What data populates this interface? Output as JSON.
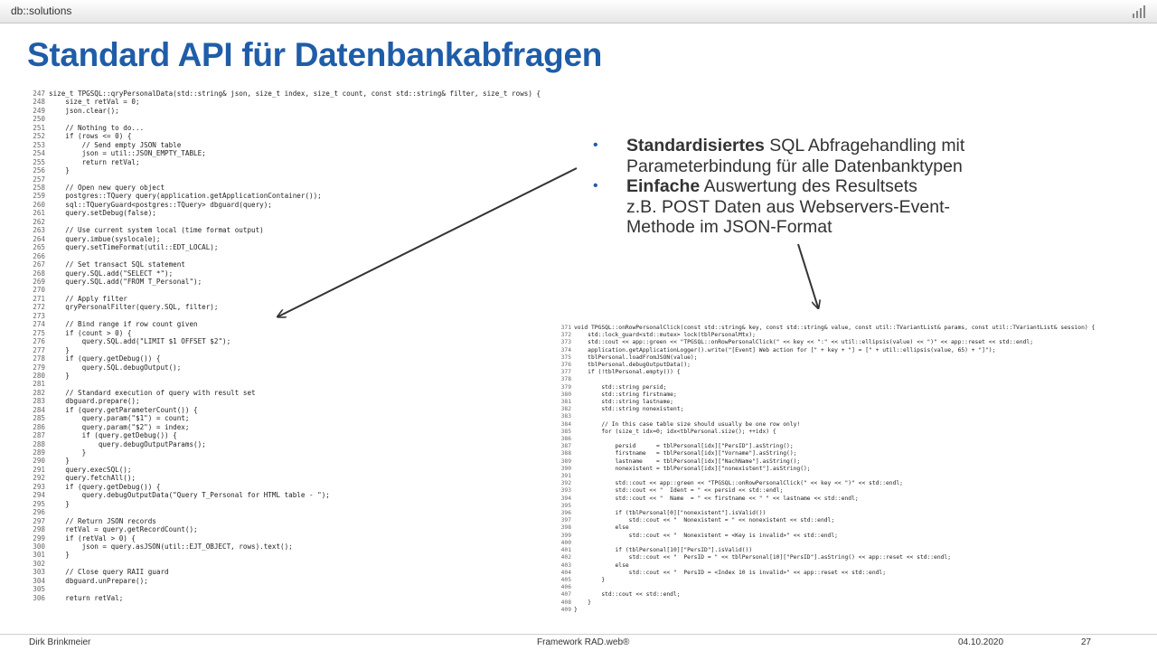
{
  "header": {
    "brand": "db::solutions",
    "logo_icon": "bars-icon"
  },
  "title": "Standard API für Datenbankabfragen",
  "bullets": [
    {
      "bold": "Standardisiertes",
      "lines": [
        " SQL Abfragehandling mit",
        "Parameterbindung für alle Datenbanktypen"
      ]
    },
    {
      "bold": "Einfache",
      "lines": [
        " Auswertung des Resultsets",
        "z.B. POST Daten aus Webservers-Event-",
        "Methode im JSON-Format"
      ]
    }
  ],
  "code_left": [
    [
      "247",
      "size_t TPGSQL::qryPersonalData(std::string& json, size_t index, size_t count, const std::string& filter, size_t rows) {"
    ],
    [
      "248",
      "    size_t retVal = 0;"
    ],
    [
      "249",
      "    json.clear();"
    ],
    [
      "250",
      ""
    ],
    [
      "251",
      "    // Nothing to do..."
    ],
    [
      "252",
      "    if (rows <= 0) {"
    ],
    [
      "253",
      "        // Send empty JSON table"
    ],
    [
      "254",
      "        json = util::JSON_EMPTY_TABLE;"
    ],
    [
      "255",
      "        return retVal;"
    ],
    [
      "256",
      "    }"
    ],
    [
      "257",
      ""
    ],
    [
      "258",
      "    // Open new query object"
    ],
    [
      "259",
      "    postgres::TQuery query(application.getApplicationContainer());"
    ],
    [
      "260",
      "    sql::TQueryGuard<postgres::TQuery> dbguard(query);"
    ],
    [
      "261",
      "    query.setDebug(false);"
    ],
    [
      "262",
      ""
    ],
    [
      "263",
      "    // Use current system local (time format output)"
    ],
    [
      "264",
      "    query.imbue(syslocale);"
    ],
    [
      "265",
      "    query.setTimeFormat(util::EDT_LOCAL);"
    ],
    [
      "266",
      ""
    ],
    [
      "267",
      "    // Set transact SQL statement"
    ],
    [
      "268",
      "    query.SQL.add(\"SELECT *\");"
    ],
    [
      "269",
      "    query.SQL.add(\"FROM T_Personal\");"
    ],
    [
      "270",
      ""
    ],
    [
      "271",
      "    // Apply filter"
    ],
    [
      "272",
      "    qryPersonalFilter(query.SQL, filter);"
    ],
    [
      "273",
      ""
    ],
    [
      "274",
      "    // Bind range if row count given"
    ],
    [
      "275",
      "    if (count > 0) {"
    ],
    [
      "276",
      "        query.SQL.add(\"LIMIT $1 OFFSET $2\");"
    ],
    [
      "277",
      "    }"
    ],
    [
      "278",
      "    if (query.getDebug()) {"
    ],
    [
      "279",
      "        query.SQL.debugOutput();"
    ],
    [
      "280",
      "    }"
    ],
    [
      "281",
      ""
    ],
    [
      "282",
      "    // Standard execution of query with result set"
    ],
    [
      "283",
      "    dbguard.prepare();"
    ],
    [
      "284",
      "    if (query.getParameterCount()) {"
    ],
    [
      "285",
      "        query.param(\"$1\") = count;"
    ],
    [
      "286",
      "        query.param(\"$2\") = index;"
    ],
    [
      "287",
      "        if (query.getDebug()) {"
    ],
    [
      "288",
      "            query.debugOutputParams();"
    ],
    [
      "289",
      "        }"
    ],
    [
      "290",
      "    }"
    ],
    [
      "291",
      "    query.execSQL();"
    ],
    [
      "292",
      "    query.fetchAll();"
    ],
    [
      "293",
      "    if (query.getDebug()) {"
    ],
    [
      "294",
      "        query.debugOutputData(\"Query T_Personal for HTML table - \");"
    ],
    [
      "295",
      "    }"
    ],
    [
      "296",
      ""
    ],
    [
      "297",
      "    // Return JSON records"
    ],
    [
      "298",
      "    retVal = query.getRecordCount();"
    ],
    [
      "299",
      "    if (retVal > 0) {"
    ],
    [
      "300",
      "        json = query.asJSON(util::EJT_OBJECT, rows).text();"
    ],
    [
      "301",
      "    }"
    ],
    [
      "302",
      ""
    ],
    [
      "303",
      "    // Close query RAII guard"
    ],
    [
      "304",
      "    dbguard.unPrepare();"
    ],
    [
      "305",
      ""
    ],
    [
      "306",
      "    return retVal;"
    ]
  ],
  "code_right": [
    [
      "371",
      "void TPGSQL::onRowPersonalClick(const std::string& key, const std::string& value, const util::TVariantList& params, const util::TVariantList& session) {"
    ],
    [
      "372",
      "    std::lock_guard<std::mutex> lock(tblPersonalMtx);"
    ],
    [
      "373",
      "    std::cout << app::green << \"TPGSQL::onRowPersonalClick(\" << key << \":\" << util::ellipsis(value) << \")\" << app::reset << std::endl;"
    ],
    [
      "374",
      "    application.getApplicationLogger().write(\"[Event] Web action for [\" + key + \"] = [\" + util::ellipsis(value, 65) + \"]\");"
    ],
    [
      "375",
      "    tblPersonal.loadFromJSON(value);"
    ],
    [
      "376",
      "    tblPersonal.debugOutputData();"
    ],
    [
      "377",
      "    if (!tblPersonal.empty()) {"
    ],
    [
      "378",
      ""
    ],
    [
      "379",
      "        std::string persid;"
    ],
    [
      "380",
      "        std::string firstname;"
    ],
    [
      "381",
      "        std::string lastname;"
    ],
    [
      "382",
      "        std::string nonexistent;"
    ],
    [
      "383",
      ""
    ],
    [
      "384",
      "        // In this case table size should usually be one row only!"
    ],
    [
      "385",
      "        for (size_t idx=0; idx<tblPersonal.size(); ++idx) {"
    ],
    [
      "386",
      ""
    ],
    [
      "387",
      "            persid      = tblPersonal[idx][\"PersID\"].asString();"
    ],
    [
      "388",
      "            firstname   = tblPersonal[idx][\"Vorname\"].asString();"
    ],
    [
      "389",
      "            lastname    = tblPersonal[idx][\"NachName\"].asString();"
    ],
    [
      "390",
      "            nonexistent = tblPersonal[idx][\"nonexistent\"].asString();"
    ],
    [
      "391",
      ""
    ],
    [
      "392",
      "            std::cout << app::green << \"TPGSQL::onRowPersonalClick(\" << key << \")\" << std::endl;"
    ],
    [
      "393",
      "            std::cout << \"  Ident = \" << persid << std::endl;"
    ],
    [
      "394",
      "            std::cout << \"  Name  = \" << firstname << \" \" << lastname << std::endl;"
    ],
    [
      "395",
      ""
    ],
    [
      "396",
      "            if (tblPersonal[0][\"nonexistent\"].isValid())"
    ],
    [
      "397",
      "                std::cout << \"  Nonexistent = \" << nonexistent << std::endl;"
    ],
    [
      "398",
      "            else"
    ],
    [
      "399",
      "                std::cout << \"  Nonexistent = <Key is invalid>\" << std::endl;"
    ],
    [
      "400",
      ""
    ],
    [
      "401",
      "            if (tblPersonal[10][\"PersID\"].isValid())"
    ],
    [
      "402",
      "                std::cout << \"  PersID = \" << tblPersonal[10][\"PersID\"].asString() << app::reset << std::endl;"
    ],
    [
      "403",
      "            else"
    ],
    [
      "404",
      "                std::cout << \"  PersID = <Index 10 is invalid>\" << app::reset << std::endl;"
    ],
    [
      "405",
      "        }"
    ],
    [
      "406",
      ""
    ],
    [
      "407",
      "        std::cout << std::endl;"
    ],
    [
      "408",
      "    }"
    ],
    [
      "409",
      "}"
    ]
  ],
  "footer": {
    "author": "Dirk Brinkmeier",
    "product": "Framework RAD.web®",
    "date": "04.10.2020",
    "page": "27"
  }
}
